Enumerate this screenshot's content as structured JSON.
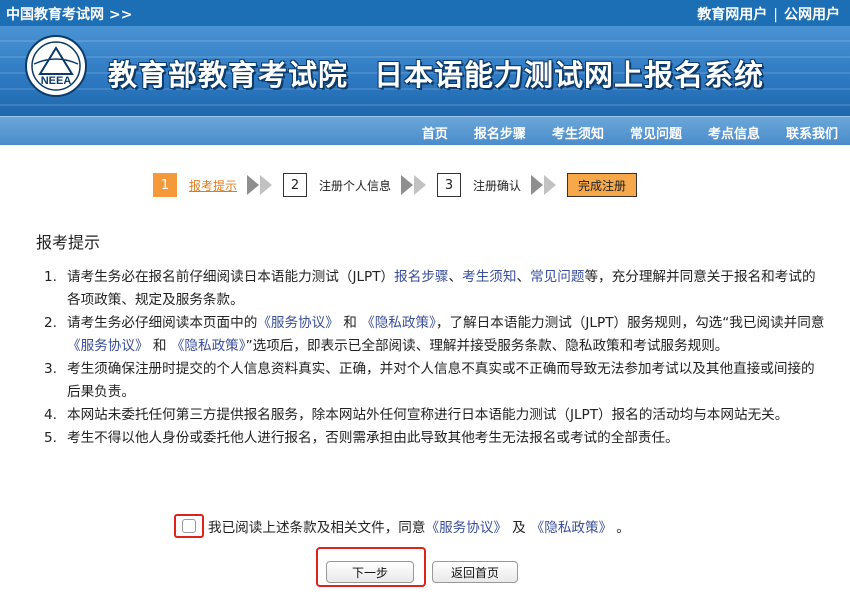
{
  "header": {
    "site_link": "中国教育考试网 >>",
    "user_edu": "教育网用户",
    "user_sep": "|",
    "user_public": "公网用户"
  },
  "banner": {
    "logo_text": "NEEA",
    "title_part1": "教育部教育考试院",
    "title_part2": "日本语能力测试网上报名系统"
  },
  "nav": [
    "首页",
    "报名步骤",
    "考生须知",
    "常见问题",
    "考点信息",
    "联系我们"
  ],
  "steps": [
    {
      "num": "1",
      "label": "报考提示"
    },
    {
      "num": "2",
      "label": "注册个人信息"
    },
    {
      "num": "3",
      "label": "注册确认"
    }
  ],
  "steps_final": "完成注册",
  "heading": "报考提示",
  "terms": [
    {
      "n": "1.",
      "p1": "请考生务必在报名前仔细阅读日本语能力测试（JLPT）",
      "l1": "报名步骤",
      "p2": "、",
      "l2": "考生须知",
      "p3": "、",
      "l3": "常见问题",
      "p4": "等，充分理解并同意关于报名和考试的各项政策、规定及服务条款。"
    },
    {
      "n": "2.",
      "p1": "请考生务必仔细阅读本页面中的",
      "l1": "《服务协议》",
      "p2": "和",
      "l2": "《隐私政策》",
      "p3": "，了解日本语能力测试（JLPT）服务规则，勾选“我已阅读并同意",
      "l3": "《服务协议》",
      "p4": "和",
      "l4": "《隐私政策》",
      "p5": "”选项后，即表示已全部阅读、理解并接受服务条款、隐私政策和考试服务规则。"
    },
    {
      "n": "3.",
      "text": "考生须确保注册时提交的个人信息资料真实、正确，并对个人信息不真实或不正确而导致无法参加考试以及其他直接或间接的后果负责。"
    },
    {
      "n": "4.",
      "text": "本网站未委托任何第三方提供报名服务，除本网站外任何宣称进行日本语能力测试（JLPT）报名的活动均与本网站无关。"
    },
    {
      "n": "5.",
      "text": "考生不得以他人身份或委托他人进行报名，否则需承担由此导致其他考生无法报名或考试的全部责任。"
    }
  ],
  "agree": {
    "p1": "我已阅读上述条款及相关文件，同意",
    "l1": "《服务协议》",
    "p2": "及",
    "l2": "《隐私政策》",
    "p3": "。"
  },
  "buttons": {
    "next": "下一步",
    "home": "返回首页"
  },
  "colors": {
    "header_bg": "#1d6fb5",
    "step_active": "#f59a3a",
    "finish_bg": "#f7a84a",
    "link": "#3a4f99",
    "highlight": "#e0221c"
  }
}
